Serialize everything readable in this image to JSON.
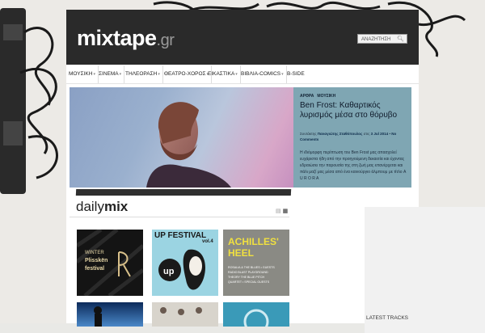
{
  "site": {
    "logo_main": "mixtape",
    "logo_suffix": ".gr",
    "search_placeholder": "ΑΝΑΖΗΤΗΣΗ"
  },
  "nav": {
    "items": [
      {
        "label": "ΜΟΥΣΙΚΗ",
        "dropdown": true
      },
      {
        "label": "ΣΙΝΕΜΑ",
        "dropdown": true
      },
      {
        "label": "ΤΗΛΕΟΡΑΣΗ",
        "dropdown": true
      },
      {
        "label": "ΘΕΑΤΡΟ-ΧΟΡΟΣ",
        "dropdown": true
      },
      {
        "label": "ΕΙΚΑΣΤΙΚΑ",
        "dropdown": true
      },
      {
        "label": "ΒΙΒΛΙΑ-COMICS",
        "dropdown": true
      },
      {
        "label": "B-SIDE",
        "dropdown": false
      }
    ]
  },
  "featured": {
    "tag1": "ΑΡΘΡΑ",
    "tag2": "ΜΟΥΣΙΚΗ",
    "title": "Ben Frost: Καθαρτικός λυρισμός μέσα στο θόρυβο",
    "meta_prefix": "Συντάκτης",
    "author": "Παναγιώτης Σταθόπουλος",
    "date_prefix": "στις",
    "date": "3 Jul 2014",
    "comments": "No Comments",
    "excerpt": "Η ιδιόμορφη περίπτωση του Ben Frost μας απασχολεί ευχάριστα ήδη από την προηγούμενη δεκαετία και έχοντας εδραιώσει την παρουσία της στη ζωή μας επανέρχεται και πάλι μαζί μας μέσα από ένα καινούργιο άλμπουμ με τίτλο A U R O R A"
  },
  "dailymix": {
    "title_light": "daily",
    "title_bold": "mix",
    "tiles": [
      {
        "line1": "WINTER",
        "line2": "Plisskën",
        "line3": "festival"
      },
      {
        "line1": "UP FESTIVAL",
        "line2": "vol.4"
      },
      {
        "line1": "ACHILLES'",
        "line2": "HEEL",
        "small": "ROSALIA & THE BLUES • GUESTS  RADIO BLAST  PLAYGROUND THEORY  THE BLUE PITCH QUARTET • SPECIAL GUESTS"
      }
    ]
  },
  "sidebar": {
    "latest_tracks": "LATEST TRACKS"
  },
  "colors": {
    "header_bg": "#2a2a2a",
    "panel_bg": "#7fa6b3",
    "accent": "#0d2b4a"
  }
}
